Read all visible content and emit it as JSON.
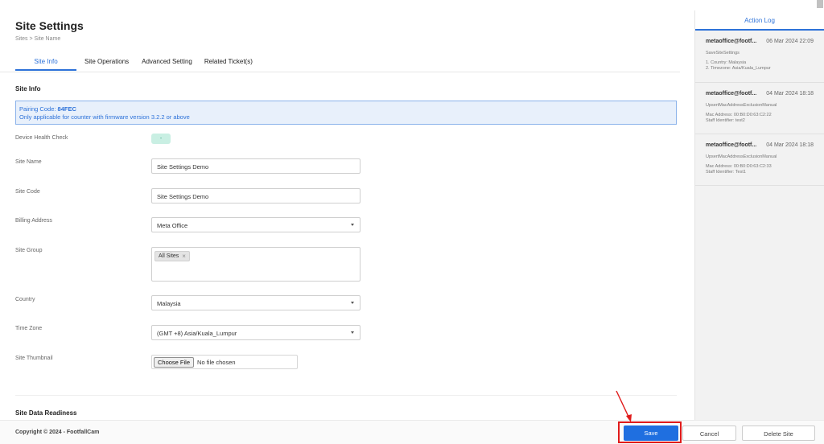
{
  "page": {
    "title": "Site Settings",
    "breadcrumb": "Sites > Site Name"
  },
  "tabs": [
    "Site Info",
    "Site Operations",
    "Advanced Setting",
    "Related Ticket(s)"
  ],
  "section": {
    "site_info": "Site Info",
    "data_readiness": "Site Data Readiness"
  },
  "pairing": {
    "label": "Pairing Code:",
    "code": "84FEC",
    "note": "Only applicable for counter with firmware version 3.2.2 or above"
  },
  "form": {
    "health_label": "Device Health Check",
    "health_value": "-",
    "site_name_label": "Site Name",
    "site_name_value": "Site Settings Demo",
    "site_code_label": "Site Code",
    "site_code_value": "Site Settings Demo",
    "billing_label": "Billing Address",
    "billing_value": "Meta Office",
    "group_label": "Site Group",
    "group_chip": "All Sites",
    "group_chip_remove": "×",
    "country_label": "Country",
    "country_value": "Malaysia",
    "timezone_label": "Time Zone",
    "timezone_value": "(GMT +8) Asia/Kuala_Lumpur",
    "thumbnail_label": "Site Thumbnail",
    "file_button": "Choose File",
    "file_status": "No file chosen"
  },
  "footer": {
    "copyright": "Copyright © 2024 - FootfallCam",
    "save": "Save",
    "cancel": "Cancel",
    "delete": "Delete Site"
  },
  "action_log": {
    "title": "Action Log",
    "entries": [
      {
        "user": "metaoffice@footf...",
        "date": "06 Mar 2024 22:09",
        "action": "SaveSiteSettings",
        "line1": "1. Country: Malaysia",
        "line2": "2. Timezone: Asia/Kuala_Lumpur"
      },
      {
        "user": "metaoffice@footf...",
        "date": "04 Mar 2024 18:18",
        "action": "UpsertMacAddressExclusionManual",
        "line1": "Mac Address: 00:B0:D0:63:C2:22",
        "line2": "Staff Identifier: test2"
      },
      {
        "user": "metaoffice@footf...",
        "date": "04 Mar 2024 18:18",
        "action": "UpsertMacAddressExclusionManual",
        "line1": "Mac Address: 00:B0:D0:63:C2:33",
        "line2": "Staff Identifier: Test1"
      }
    ]
  },
  "colors": {
    "accent": "#2d72d9",
    "highlight": "#e01b1b",
    "save_button": "#1f6fe0"
  }
}
